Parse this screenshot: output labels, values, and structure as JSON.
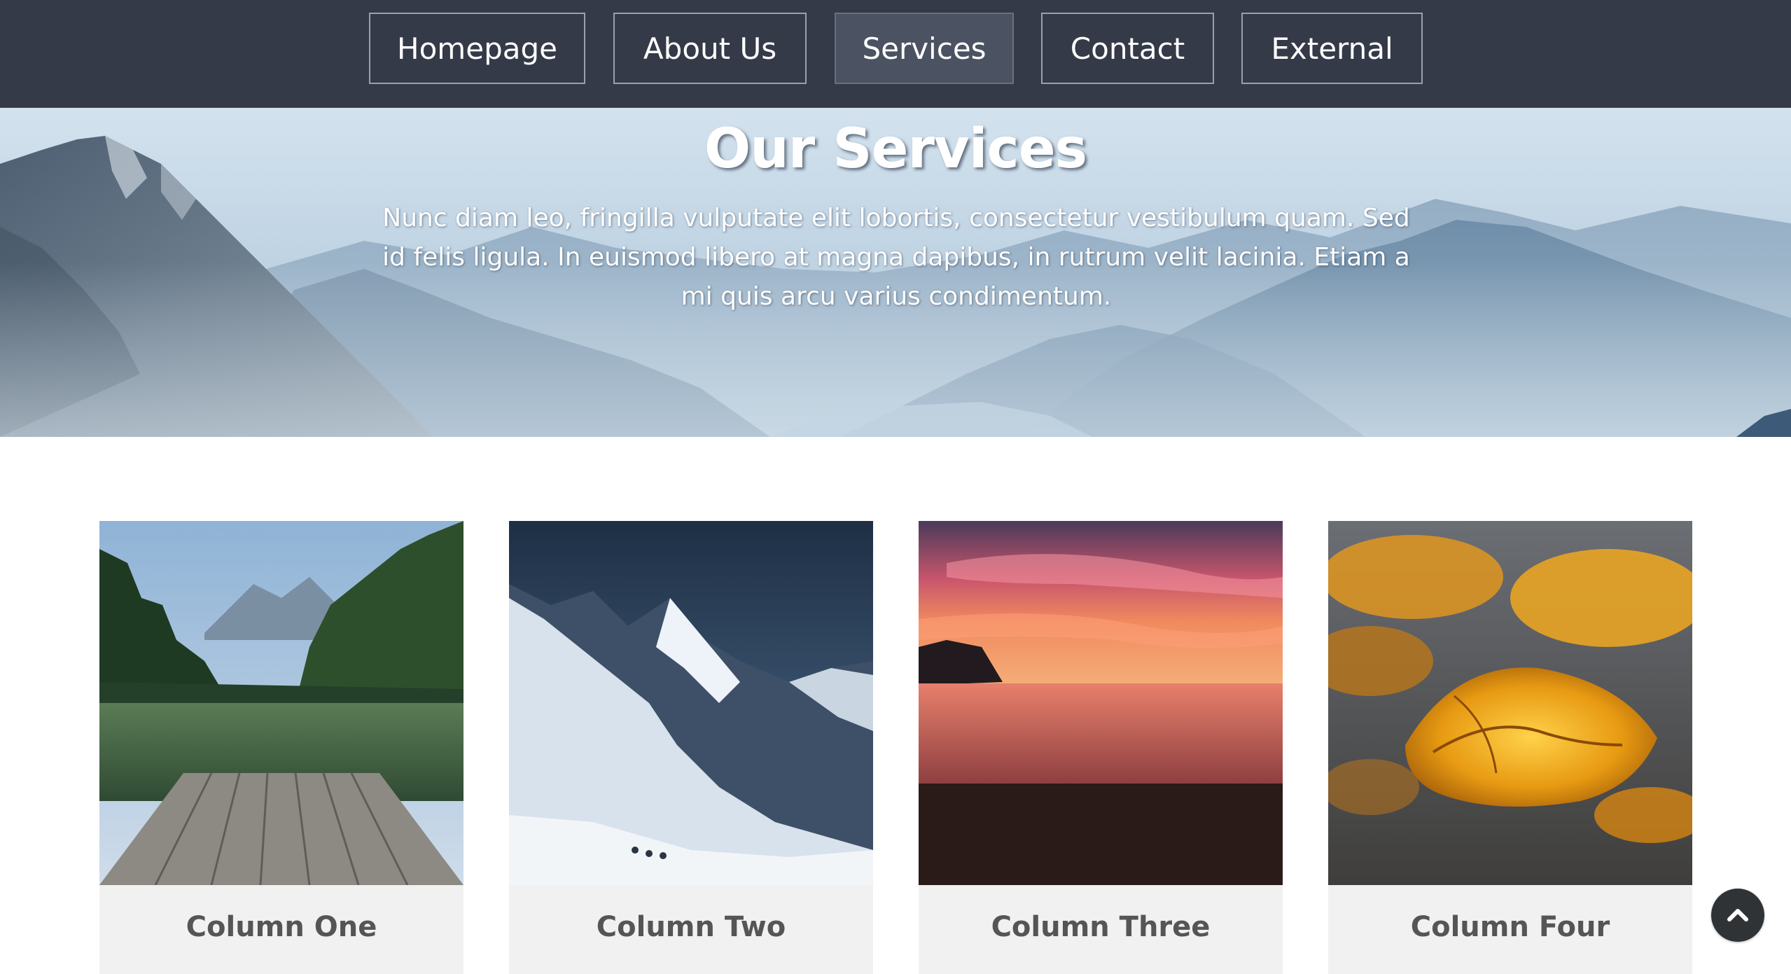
{
  "nav": {
    "items": [
      {
        "label": "Homepage",
        "active": false
      },
      {
        "label": "About Us",
        "active": false
      },
      {
        "label": "Services",
        "active": true
      },
      {
        "label": "Contact",
        "active": false
      },
      {
        "label": "External",
        "active": false
      }
    ]
  },
  "hero": {
    "title": "Our Services",
    "text": "Nunc diam leo, fringilla vulputate elit lobortis, consectetur vestibulum quam. Sed id felis ligula. In euismod libero at magna dapibus, in rutrum velit lacinia. Etiam a mi quis arcu varius condimentum."
  },
  "columns": [
    {
      "title": "Column One",
      "image": "lake-dock-photo"
    },
    {
      "title": "Column Two",
      "image": "snowy-mountain-photo"
    },
    {
      "title": "Column Three",
      "image": "sunset-beach-photo"
    },
    {
      "title": "Column Four",
      "image": "autumn-leaves-photo"
    }
  ],
  "colors": {
    "nav_background": "#353a48",
    "active_nav_background": "#4b5261",
    "caption_background": "#f1f1f1",
    "caption_text": "#555555"
  },
  "back_to_top": {
    "icon": "chevron-up-icon"
  }
}
